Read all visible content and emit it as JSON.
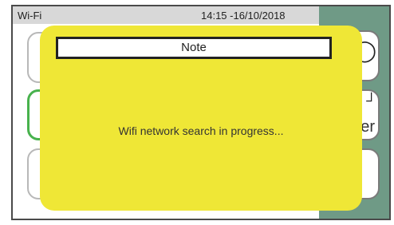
{
  "status_bar": {
    "title": "Wi-Fi",
    "datetime": "14:15 -16/10/2018"
  },
  "background_cards": {
    "right_card_bottom_text": "er"
  },
  "dialog": {
    "title": "Note",
    "message": "Wifi network search in progress..."
  },
  "colors": {
    "dialog_background": "#efe736",
    "side_panel": "#6f9a86",
    "selected_card_border": "#48b24d"
  }
}
